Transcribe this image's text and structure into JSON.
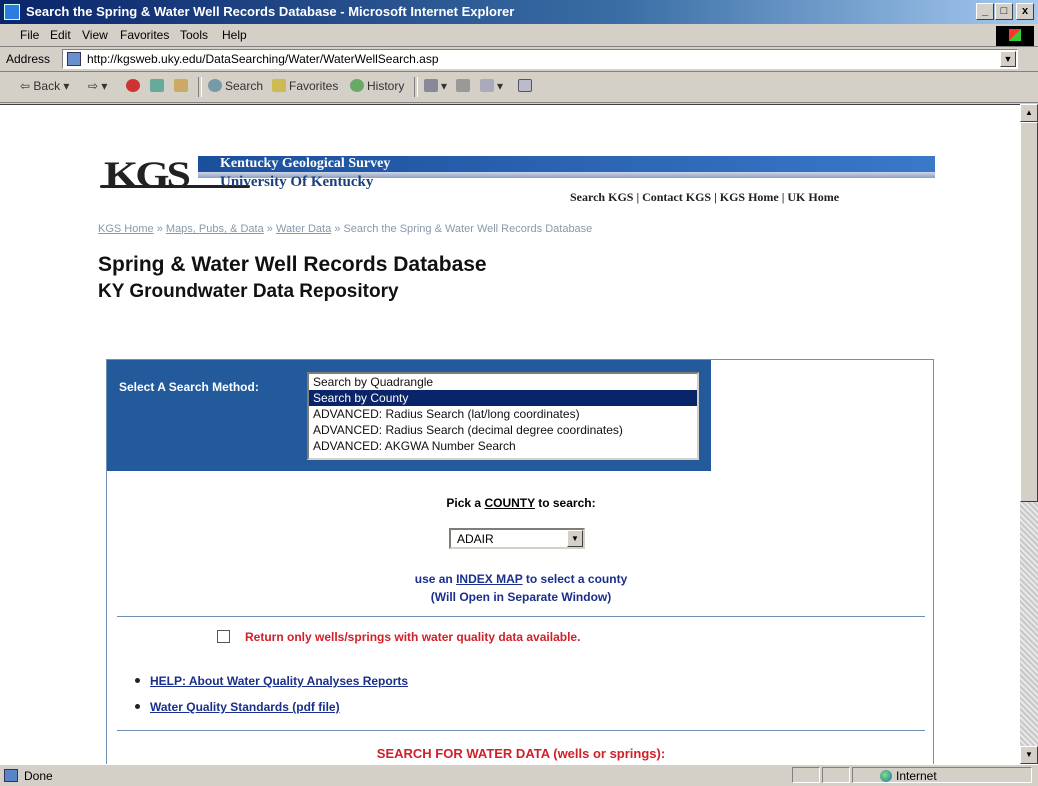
{
  "window": {
    "title": "Search the Spring & Water Well Records Database - Microsoft Internet Explorer",
    "controls": [
      "_",
      "□",
      "x"
    ]
  },
  "menu": [
    "File",
    "Edit",
    "View",
    "Favorites",
    "Tools",
    "Help"
  ],
  "address": {
    "label": "Address",
    "url": "http://kgsweb.uky.edu/DataSearching/Water/WaterWellSearch.asp"
  },
  "toolbar": {
    "back": "Back",
    "search": "Search",
    "favorites": "Favorites",
    "history": "History"
  },
  "banner": {
    "logo": "KGS",
    "org": "Kentucky Geological Survey",
    "university": "University Of Kentucky",
    "links": "Search KGS | Contact KGS | KGS Home | UK Home"
  },
  "breadcrumb": {
    "items": [
      "KGS Home",
      "Maps, Pubs, & Data",
      "Water Data"
    ],
    "separator": "»",
    "current": "Search the Spring & Water Well Records Database"
  },
  "page": {
    "title": "Spring & Water Well Records Database",
    "subtitle": "KY Groundwater Data Repository"
  },
  "method": {
    "label": "Select A Search Method:",
    "options": [
      "Search by Quadrangle",
      "Search by County",
      "ADVANCED: Radius Search (lat/long coordinates)",
      "ADVANCED: Radius Search (decimal degree coordinates)",
      "ADVANCED: AKGWA Number Search"
    ],
    "selected_index": 1
  },
  "county": {
    "pick_prefix": "Pick a ",
    "pick_key": "COUNTY",
    "pick_suffix": " to search:",
    "selected": "ADAIR",
    "index_prefix": "use an ",
    "index_link": "INDEX MAP",
    "index_suffix": " to select a county",
    "note": "(Will Open in Separate Window)"
  },
  "quality": {
    "checkbox_label": "Return only wells/springs with water quality data available.",
    "checked": false,
    "links": [
      "HELP: About Water Quality Analyses Reports",
      "Water Quality Standards (pdf file)"
    ]
  },
  "search_heading": "SEARCH FOR WATER DATA (wells or springs):",
  "status": {
    "text": "Done",
    "zone": "Internet"
  }
}
